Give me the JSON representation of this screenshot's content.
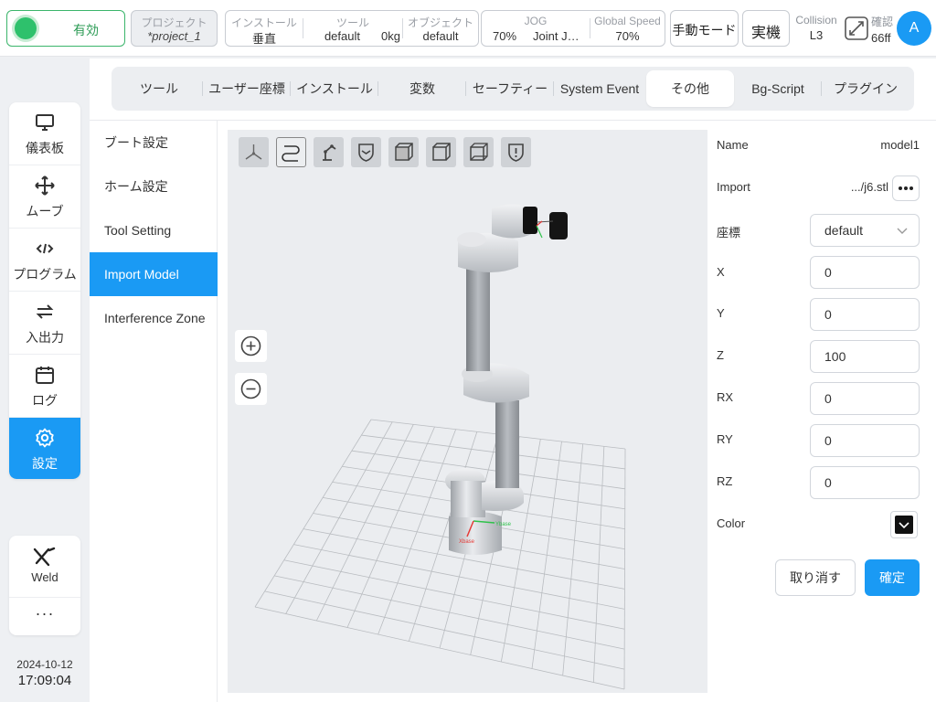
{
  "topbar": {
    "status_label": "有効",
    "project": {
      "title": "プロジェクト",
      "name": "*project_1"
    },
    "install": {
      "title": "インストール",
      "value": "垂直"
    },
    "tool": {
      "title": "ツール",
      "name": "default",
      "payload": "0kg"
    },
    "object": {
      "title": "オブジェクト",
      "value": "default"
    },
    "jog": {
      "title": "JOG",
      "speed": "70%",
      "mode": "Joint J…"
    },
    "global_speed": {
      "title": "Global Speed",
      "value": "70%"
    },
    "manual_mode": "手動モード",
    "real_robot": "実機",
    "collision": {
      "title": "Collision",
      "level": "L3"
    },
    "confirm": {
      "title": "確認",
      "value": "66ff"
    },
    "avatar_letter": "A"
  },
  "nav": {
    "items": [
      {
        "label": "儀表板",
        "icon": "monitor-icon"
      },
      {
        "label": "ムーブ",
        "icon": "move-arrows-icon"
      },
      {
        "label": "プログラム",
        "icon": "code-icon"
      },
      {
        "label": "入出力",
        "icon": "swap-icon"
      },
      {
        "label": "ログ",
        "icon": "calendar-icon"
      },
      {
        "label": "設定",
        "icon": "gear-icon"
      }
    ],
    "weld_label": "Weld",
    "more_label": "···"
  },
  "clock": {
    "date": "2024-10-12",
    "time": "17:09:04"
  },
  "tabs": [
    "ツール",
    "ユーザー座標",
    "インストール",
    "変数",
    "セーフティー",
    "System Event",
    "その他",
    "Bg-Script",
    "プラグイン"
  ],
  "submenu": [
    "ブート設定",
    "ホーム設定",
    "Tool Setting",
    "Import Model",
    "Interference Zone"
  ],
  "form": {
    "name_label": "Name",
    "name_value": "model1",
    "import_label": "Import",
    "import_value": ".../j6.stl",
    "coord_label": "座標",
    "coord_value": "default",
    "x_label": "X",
    "x_value": "0",
    "y_label": "Y",
    "y_value": "0",
    "z_label": "Z",
    "z_value": "100",
    "rx_label": "RX",
    "rx_value": "0",
    "ry_label": "RY",
    "ry_value": "0",
    "rz_label": "RZ",
    "rz_value": "0",
    "color_label": "Color",
    "color_value": "#111111",
    "cancel_label": "取り消す",
    "ok_label": "確定"
  },
  "viewport": {
    "axis_labels": {
      "x": "Xbase",
      "y": "Ybase"
    }
  },
  "colors": {
    "accent": "#1a9af4",
    "active_green": "#2ec16c"
  }
}
